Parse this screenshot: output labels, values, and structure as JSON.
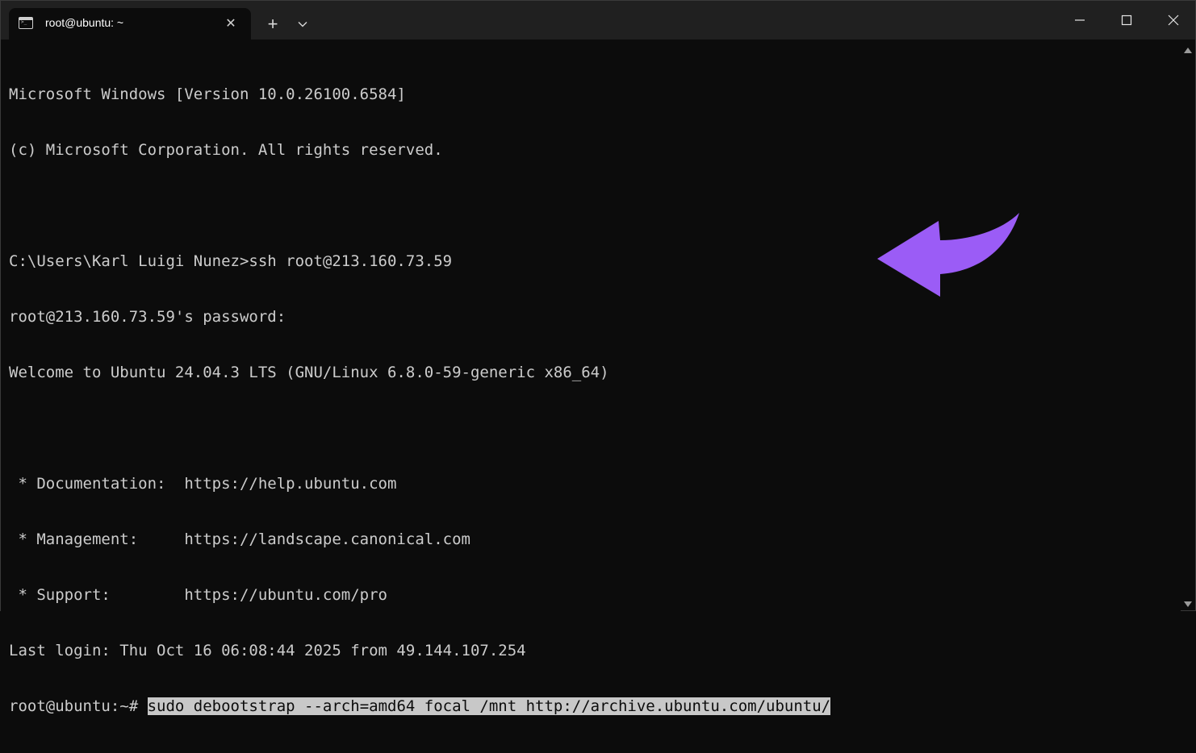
{
  "window": {
    "tab_title": "root@ubuntu: ~",
    "tab_close": "✕",
    "new_tab": "+",
    "icons": {
      "tab_icon": "terminal-icon",
      "dropdown": "chevron-down-icon",
      "minimize": "minimize-icon",
      "maximize": "maximize-icon",
      "close": "close-icon"
    }
  },
  "terminal": {
    "lines": [
      "Microsoft Windows [Version 10.0.26100.6584]",
      "(c) Microsoft Corporation. All rights reserved.",
      "",
      "C:\\Users\\Karl Luigi Nunez>ssh root@213.160.73.59",
      "root@213.160.73.59's password:",
      "Welcome to Ubuntu 24.04.3 LTS (GNU/Linux 6.8.0-59-generic x86_64)",
      "",
      " * Documentation:  https://help.ubuntu.com",
      " * Management:     https://landscape.canonical.com",
      " * Support:        https://ubuntu.com/pro",
      "Last login: Thu Oct 16 06:08:44 2025 from 49.144.107.254"
    ],
    "prompt": "root@ubuntu:~# ",
    "command": "sudo debootstrap --arch=amd64 focal /mnt http://archive.ubuntu.com/ubuntu/"
  },
  "colors": {
    "background": "#0c0c0c",
    "titlebar": "#202020",
    "text": "#cccccc",
    "selection": "#c8c8c8",
    "arrow": "#9b5cf6"
  }
}
